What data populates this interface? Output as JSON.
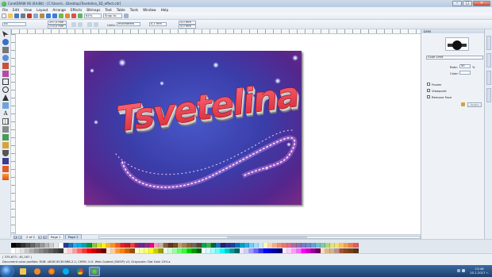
{
  "titlebar": {
    "title": "CorelDRAW X6 (64-Bit) - [C:\\Users\\…\\Desktop\\Tsvetelina_3D_effect.cdr]",
    "minimize": "–",
    "maximize": "□",
    "close": "✕"
  },
  "menu": [
    "File",
    "Edit",
    "View",
    "Layout",
    "Arrange",
    "Effects",
    "Bitmaps",
    "Text",
    "Table",
    "Tools",
    "Window",
    "Help"
  ],
  "toolbar": {
    "zoom": "64%",
    "snap": "Snap to"
  },
  "propbar": {
    "page_size": "A4",
    "width": "297,0 mm",
    "height": "210,0 mm",
    "units_label": "Units:",
    "units": "millimeters",
    "nudge": "0,1 mm",
    "dup_x": "5,0 mm",
    "dup_y": "5,0 mm"
  },
  "pagebar": {
    "count": "2 of 2",
    "tab1": "Page 1",
    "tab2": "Page 2",
    "first": "|◂",
    "prev": "◂",
    "next": "▸",
    "last": "▸|"
  },
  "artwork": {
    "text": "Tsvetelina",
    "colors": {
      "text_fill": "#e83a4a",
      "bg_top": "#3a3eaa",
      "bg_bottom": "#7a2a86"
    }
  },
  "status": {
    "coords": "( 375,673 ; 61,167 )",
    "profiles": "Document color profiles: RGB: sRGB IEC61966-2.1; CMYK: U.S. Web Coated (SWOP) v2; Grayscale: Dot Gain 20% ▸"
  },
  "docker": {
    "title": "Lens",
    "lens_type": "Color Limit",
    "rate_label": "Rate:",
    "rate": "50",
    "rate_unit": "%",
    "color_label": "Color:",
    "frozen": "Frozen",
    "viewpoint": "Viewpoint",
    "remove_face": "Remove Face",
    "apply": "Apply"
  },
  "palette_colors": {
    "row1": [
      "#000000",
      "#1a1a1a",
      "#333333",
      "#4d4d4d",
      "#666666",
      "#808080",
      "#999999",
      "#b3b3b3",
      "#cccccc",
      "#e6e6e6",
      "#ffffff",
      "#2b3990",
      "#1c75bc",
      "#27aae1",
      "#00aeef",
      "#00a79d",
      "#009444",
      "#8dc63f",
      "#d7df23",
      "#fff200",
      "#fbb040",
      "#f7941d",
      "#f15a29",
      "#ed1c24",
      "#be1e2d",
      "#ef4136",
      "#9e1f63",
      "#662d91",
      "#92278f",
      "#ec008c",
      "#f49ac1",
      "#c2b59b",
      "#8b5e3c",
      "#603913",
      "#754c24",
      "#c49a6c",
      "#a97c50",
      "#8c6239",
      "#736357",
      "#534741",
      "#00a651",
      "#39b54a",
      "#006838",
      "#1b75bb",
      "#262262",
      "#2e3192",
      "#21409a",
      "#0072bc",
      "#00a0c6",
      "#29abe2",
      "#6dcff6",
      "#a3daf4",
      "#cce8f4",
      "#fff9ae",
      "#fdd0a2",
      "#f8a98b",
      "#f48a72",
      "#e97672",
      "#d96a8c",
      "#b16aa5",
      "#8f6fb1",
      "#7a7bbb",
      "#6b8cc7",
      "#5ea6d4",
      "#6cc0c8",
      "#82c9a6",
      "#b2d57f",
      "#e0e479",
      "#f5e06b",
      "#f9c15e",
      "#f59c56",
      "#ee7a55",
      "#e15c5c"
    ],
    "row2": [
      "#ffffff",
      "#f2f2f2",
      "#e0e0e0",
      "#c9c9c9",
      "#b0b0b0",
      "#9a9a9a",
      "#878787",
      "#747474",
      "#606060",
      "#4b4b4b",
      "#363636",
      "#ffe6e6",
      "#ffcccc",
      "#ff9999",
      "#ff6666",
      "#ff3333",
      "#ff0000",
      "#cc0000",
      "#990000",
      "#660000",
      "#ffe6cc",
      "#ffcc99",
      "#ff9933",
      "#ff8000",
      "#cc6600",
      "#994c00",
      "#ffffcc",
      "#ffff99",
      "#ffff66",
      "#ffff00",
      "#cccc00",
      "#999900",
      "#e6ffe6",
      "#ccffcc",
      "#99ff99",
      "#66ff66",
      "#33ff33",
      "#00cc00",
      "#009900",
      "#006600",
      "#e6ffff",
      "#ccffff",
      "#99ffff",
      "#66ffff",
      "#00ffff",
      "#00cccc",
      "#009999",
      "#006666",
      "#e6e6ff",
      "#ccccff",
      "#9999ff",
      "#6666ff",
      "#3333ff",
      "#0000ff",
      "#0000cc",
      "#000099",
      "#000066",
      "#ffe6ff",
      "#ffccff",
      "#ff99ff",
      "#ff66ff",
      "#ff00ff",
      "#cc00cc",
      "#990099",
      "#660066",
      "#f5deb3",
      "#deb887",
      "#d2b48c",
      "#bc8f8f",
      "#a0522d",
      "#8b4513",
      "#704214",
      "#5c3317"
    ]
  },
  "taskbar": {
    "time": "13:46",
    "date": "10.1.2017 г."
  }
}
